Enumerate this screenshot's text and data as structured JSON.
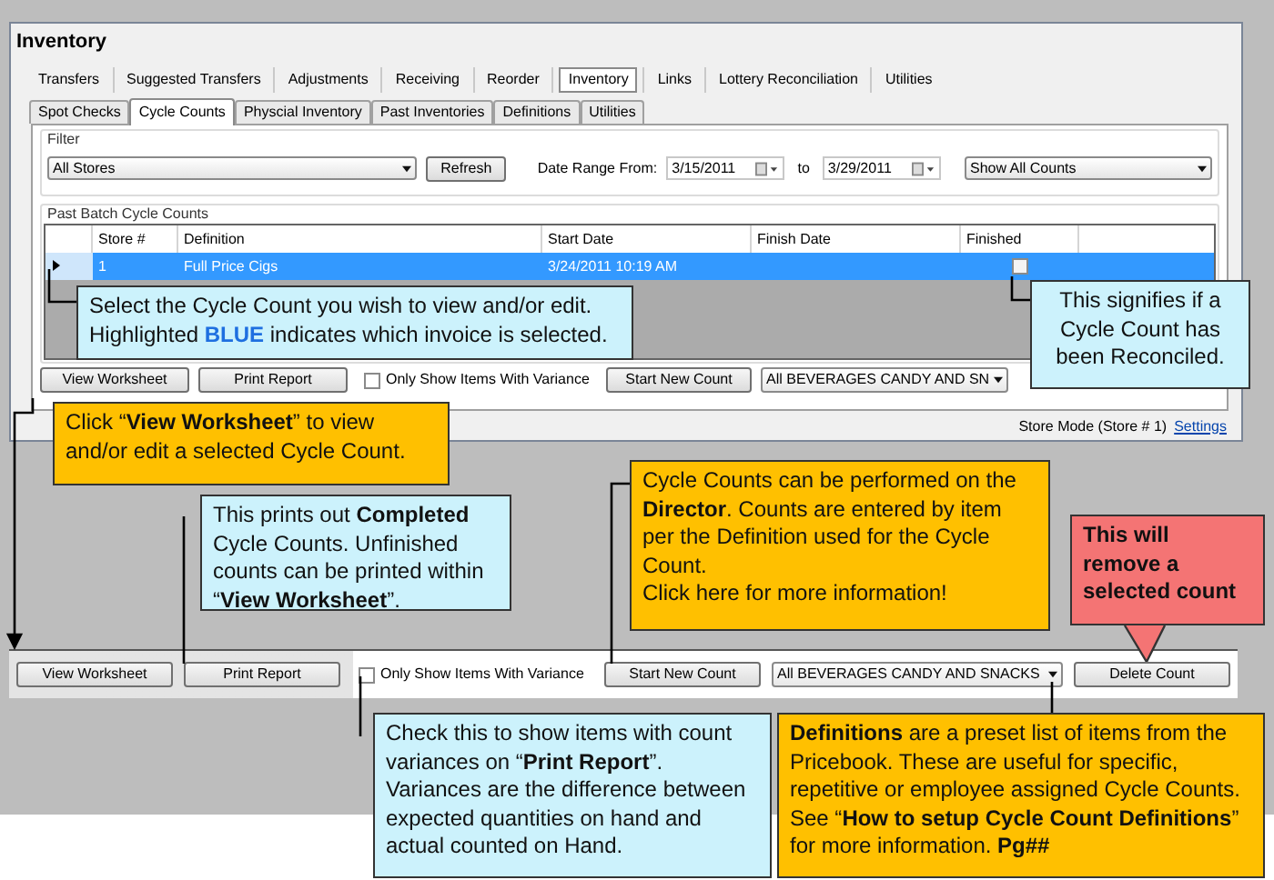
{
  "window": {
    "title": "Inventory"
  },
  "main_tabs": [
    {
      "label": "Transfers",
      "selected": false
    },
    {
      "label": "Suggested Transfers",
      "selected": false
    },
    {
      "label": "Adjustments",
      "selected": false
    },
    {
      "label": "Receiving",
      "selected": false
    },
    {
      "label": "Reorder",
      "selected": false
    },
    {
      "label": "Inventory",
      "selected": true
    },
    {
      "label": "Links",
      "selected": false
    },
    {
      "label": "Lottery Reconciliation",
      "selected": false
    },
    {
      "label": "Utilities",
      "selected": false
    }
  ],
  "sub_tabs": [
    {
      "label": "Spot Checks",
      "selected": false
    },
    {
      "label": "Cycle Counts",
      "selected": true
    },
    {
      "label": "Physcial Inventory",
      "selected": false
    },
    {
      "label": "Past Inventories",
      "selected": false
    },
    {
      "label": "Definitions",
      "selected": false
    },
    {
      "label": "Utilities",
      "selected": false
    }
  ],
  "filter": {
    "title": "Filter",
    "store_select": "All Stores",
    "refresh_button": "Refresh",
    "date_range_label": "Date Range From:",
    "date_from": "3/15/2011",
    "to_label": "to",
    "date_to": "3/29/2011",
    "count_select": "Show All Counts"
  },
  "grid": {
    "title": "Past Batch Cycle Counts",
    "columns": [
      "Store #",
      "Definition",
      "Start Date",
      "Finish Date",
      "Finished"
    ],
    "rows": [
      {
        "selected": true,
        "store": "1",
        "definition": "Full Price Cigs",
        "start_date": "3/24/2011 10:19 AM",
        "finished": false
      }
    ]
  },
  "toolbar": {
    "view_worksheet": "View Worksheet",
    "print_report": "Print Report",
    "variance_checkbox": {
      "label": "Only Show Items With Variance",
      "checked": false
    },
    "start_new_count": "Start New Count",
    "definition_select": "All BEVERAGES CANDY AND SN"
  },
  "status_bar": {
    "mode": "Store Mode (Store # 1)",
    "settings_link": "Settings"
  },
  "zoomed_toolbar": {
    "view_worksheet": "View Worksheet",
    "print_report": "Print Report",
    "variance_checkbox": {
      "label": "Only Show Items With Variance",
      "checked": false
    },
    "start_new_count": "Start New Count",
    "definition_select": "All BEVERAGES CANDY AND SNACKS",
    "delete_count": "Delete Count"
  },
  "callouts": [
    {
      "kind": "info",
      "paragraphs": [
        "Select the Cycle Count you wish to view and/or edit. Highlighted **BLUE** indicates which invoice is selected."
      ]
    },
    {
      "kind": "info",
      "paragraphs": [
        "This signifies if a Cycle Count has been Reconciled."
      ]
    },
    {
      "kind": "tip",
      "paragraphs": [
        "Click “**View Worksheet**” to view and/or edit a selected Cycle Count."
      ]
    },
    {
      "kind": "info",
      "paragraphs": [
        "This prints out **Completed** Cycle Counts. Unfinished counts can be printed within “**View Worksheet**”."
      ]
    },
    {
      "kind": "tip",
      "paragraphs": [
        "Cycle Counts can be performed on the **Director**. Counts are entered by item per the Definition used for the Cycle Count.",
        "Click here for more information!"
      ]
    },
    {
      "kind": "warning",
      "paragraphs": [
        "This will remove a selected count"
      ]
    },
    {
      "kind": "info",
      "paragraphs": [
        "Check this to show items with count variances on “**Print Report**”. Variances are the difference between expected quantities on hand and actual counted on Hand."
      ]
    },
    {
      "kind": "tip",
      "paragraphs": [
        "**Definitions** are a preset list of items from the Pricebook. These are useful for specific, repetitive or employee assigned Cycle Counts. See “**How to setup Cycle Count Definitions**” for more information. **Pg##**"
      ]
    }
  ]
}
